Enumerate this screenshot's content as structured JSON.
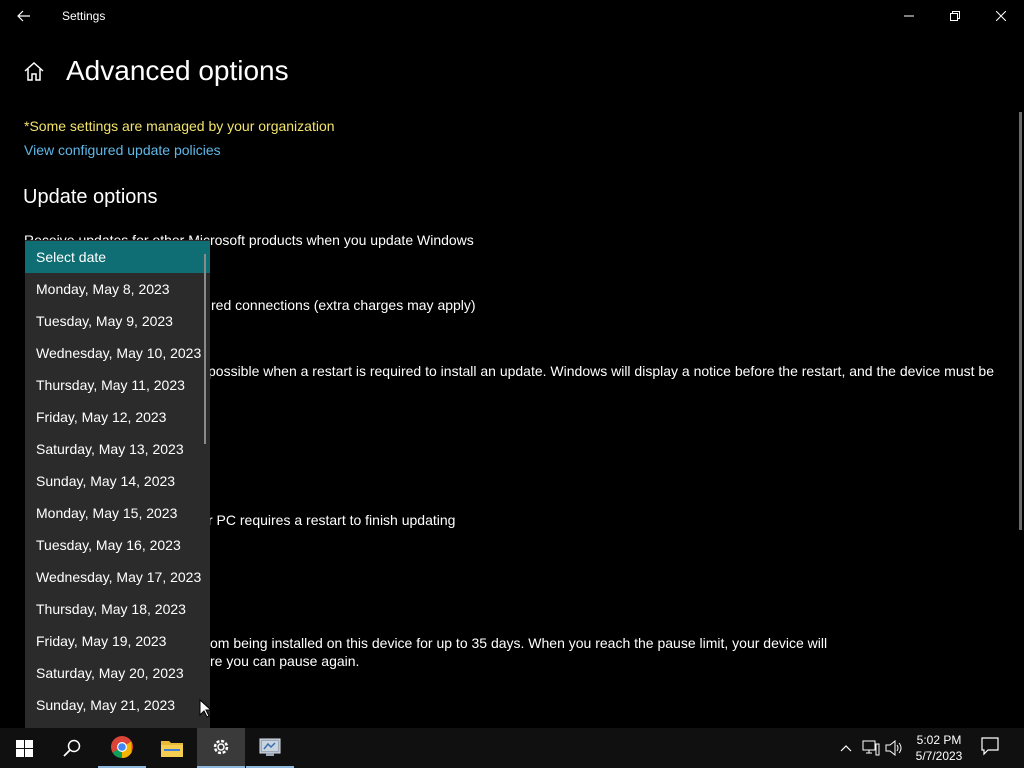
{
  "window": {
    "title": "Settings"
  },
  "page": {
    "title": "Advanced options",
    "managed_note": "*Some settings are managed by your organization",
    "policy_link": "View configured update policies",
    "section_heading": "Update options"
  },
  "partial_text": {
    "line1": "Receive updates for other Microsoft products when you update Windows",
    "line2": "red connections (extra charges may apply)",
    "line3": "possible when a restart is required to install an update. Windows will display a notice before the restart, and the device must be",
    "line4": "r PC requires a restart to finish updating",
    "line5": "om being installed on this device for up to 35 days. When you reach the pause limit, your device will",
    "line6": "re you can pause again."
  },
  "dropdown": {
    "items": [
      "Select date",
      "Monday, May 8, 2023",
      "Tuesday, May 9, 2023",
      "Wednesday, May 10, 2023",
      "Thursday, May 11, 2023",
      "Friday, May 12, 2023",
      "Saturday, May 13, 2023",
      "Sunday, May 14, 2023",
      "Monday, May 15, 2023",
      "Tuesday, May 16, 2023",
      "Wednesday, May 17, 2023",
      "Thursday, May 18, 2023",
      "Friday, May 19, 2023",
      "Saturday, May 20, 2023",
      "Sunday, May 21, 2023"
    ],
    "selected_index": 0
  },
  "taskbar": {
    "time": "5:02 PM",
    "date": "5/7/2023"
  },
  "colors": {
    "accent_selected": "#0f6e74",
    "warning_text": "#f2e36b",
    "link_text": "#5fb8e8"
  }
}
